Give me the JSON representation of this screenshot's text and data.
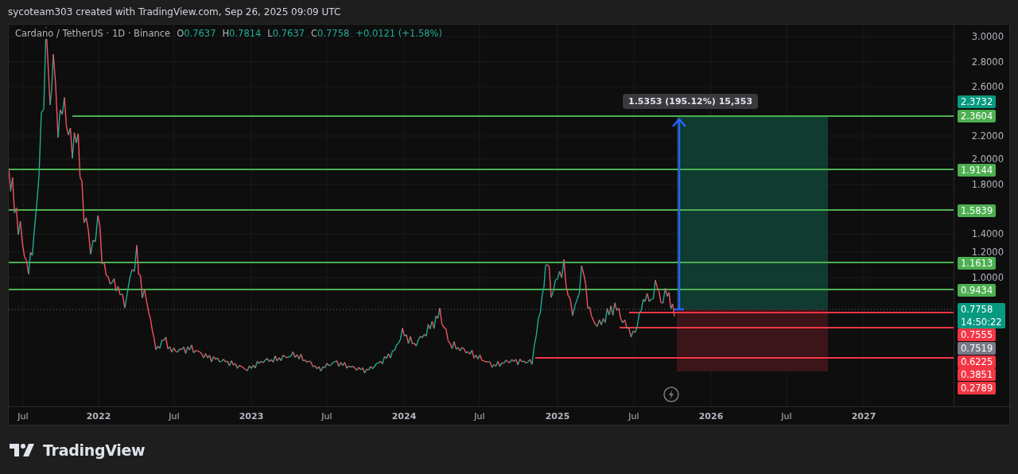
{
  "header": {
    "caption": "sycoteam303 created with TradingView.com, Sep 26, 2025 09:09 UTC"
  },
  "legend": {
    "symbol": "Cardano / TetherUS · 1D · Binance",
    "ohlc": [
      {
        "key": "O",
        "value": "0.7637"
      },
      {
        "key": "H",
        "value": "0.7814"
      },
      {
        "key": "L",
        "value": "0.7637"
      },
      {
        "key": "C",
        "value": "0.7758"
      }
    ],
    "change": "+0.0121 (+1.58%)"
  },
  "price_axis": {
    "ticks": [
      "3.0000",
      "2.8000",
      "2.6000",
      "2.2000",
      "2.0000",
      "1.8000",
      "1.4000",
      "1.2000",
      "1.0000"
    ]
  },
  "price_labels": [
    {
      "text": "2.3732",
      "color": "#089981"
    },
    {
      "text": "2.3604",
      "color": "#4caf50"
    },
    {
      "text": "1.9144",
      "color": "#4caf50"
    },
    {
      "text": "1.5839",
      "color": "#4caf50"
    },
    {
      "text": "1.1613",
      "color": "#4caf50"
    },
    {
      "text": "0.9434",
      "color": "#4caf50"
    },
    {
      "text": "0.7758",
      "countdown": "14:50:22",
      "color": "#089981"
    },
    {
      "text": "0.7555",
      "color": "#f23645"
    },
    {
      "text": "0.7519",
      "color": "#787b86"
    },
    {
      "text": "0.6225",
      "color": "#f23645"
    },
    {
      "text": "0.3851",
      "color": "#f23645"
    },
    {
      "text": "0.2789",
      "color": "#f23645"
    }
  ],
  "time_axis": {
    "ticks": [
      "Jul",
      "2022",
      "Jul",
      "2023",
      "Jul",
      "2024",
      "Jul",
      "2025",
      "Jul",
      "2026",
      "Jul",
      "2027"
    ]
  },
  "measure": {
    "label": "1.5353 (195.12%) 15,353"
  },
  "footer": {
    "brand": "TradingView"
  }
}
